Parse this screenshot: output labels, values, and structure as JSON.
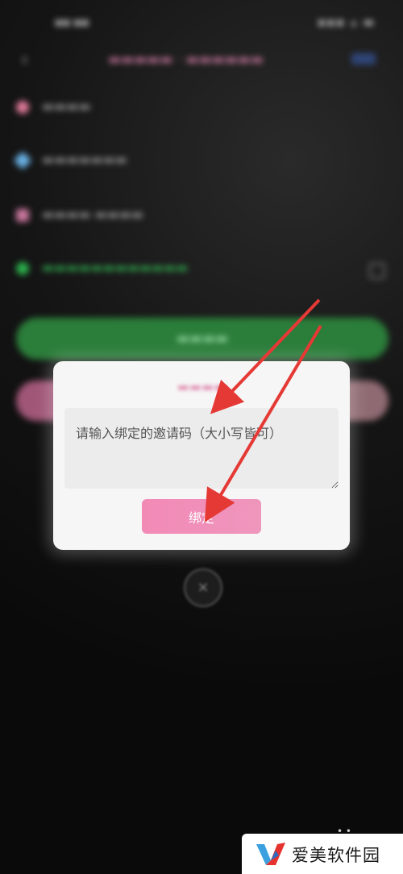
{
  "dialog": {
    "input_placeholder": "请输入绑定的邀请码（大小写皆可）",
    "bind_button_label": "绑定"
  },
  "colors": {
    "bind_button": "#f28ab6",
    "annotation_arrow": "#e53935",
    "background": "#0b0b0b",
    "green_button": "#2b7d3a"
  },
  "icons": {
    "close": "close-icon",
    "watermark_logo": "brand-logo-icon"
  },
  "watermark": {
    "text": "爱美软件园"
  }
}
